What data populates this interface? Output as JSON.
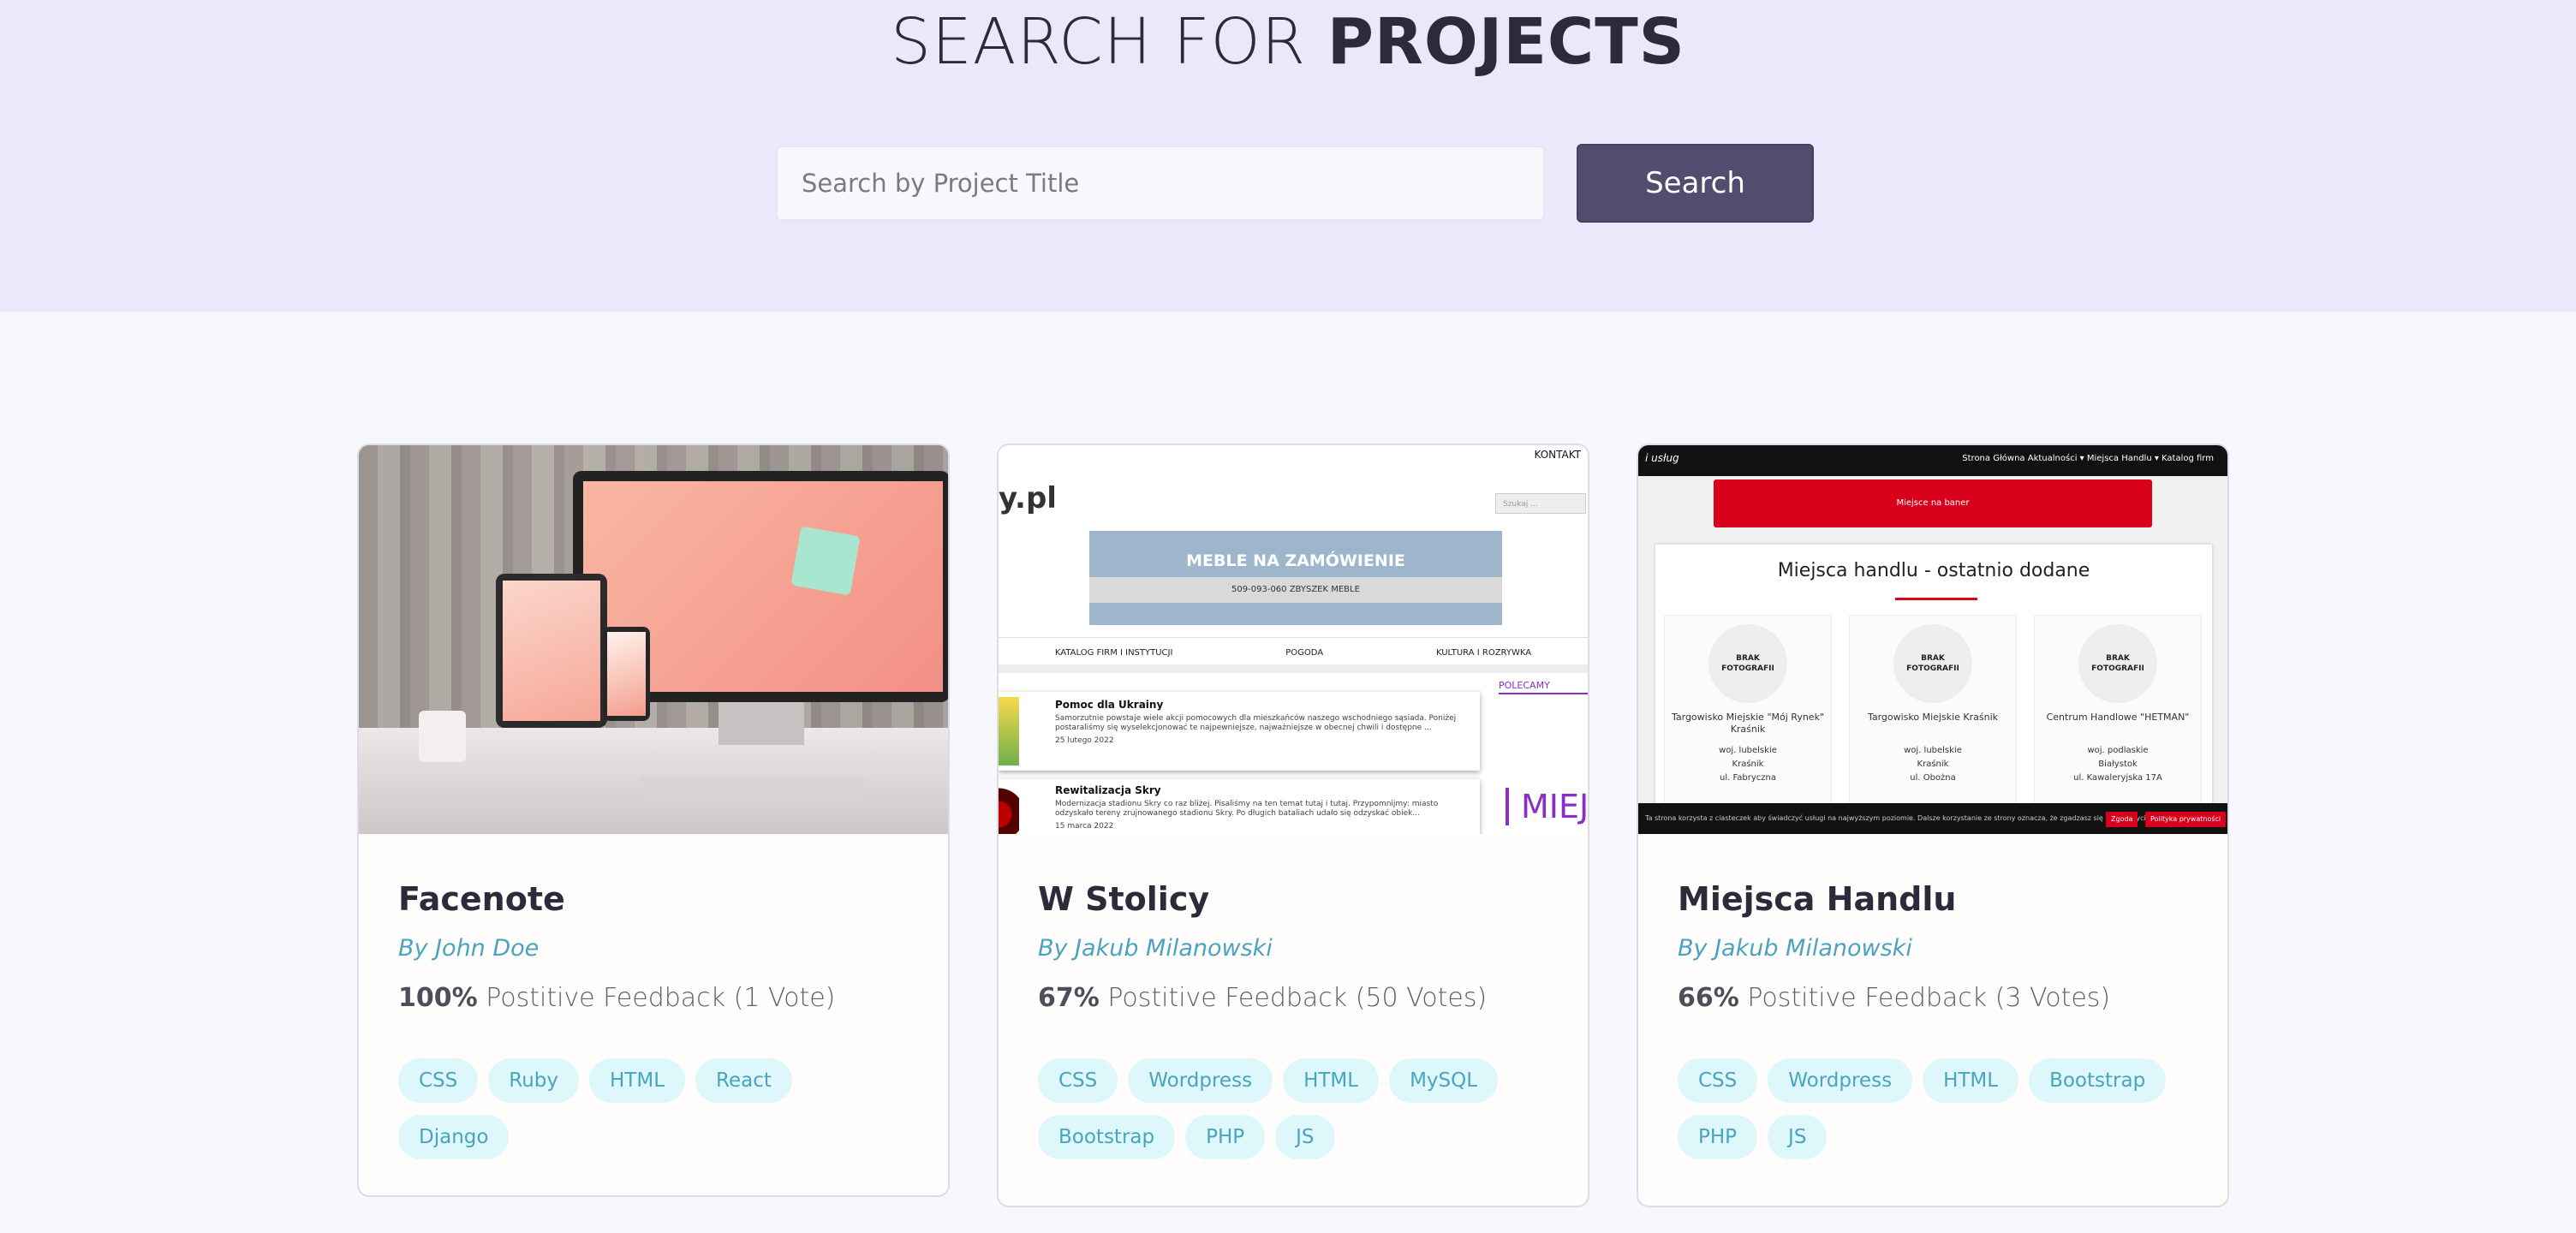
{
  "hero": {
    "title_light": "SEARCH FOR ",
    "title_bold": "PROJECTS",
    "search_placeholder": "Search by Project Title",
    "search_button": "Search"
  },
  "colors": {
    "hero_bg": "#ebe8fc",
    "page_bg": "#f7f8fd",
    "button_bg": "#524c6f",
    "author": "#4aa4c0",
    "tag_bg": "#def7fa"
  },
  "projects": [
    {
      "title": "Facenote",
      "author": "By John Doe",
      "feedback_percent": "100%",
      "feedback_text": " Postitive Feedback (1 Vote)",
      "tags": [
        "CSS",
        "Ruby",
        "HTML",
        "React",
        "Django"
      ],
      "thumbnail": {}
    },
    {
      "title": "W Stolicy",
      "author": "By Jakub Milanowski",
      "feedback_percent": "67%",
      "feedback_text": " Postitive Feedback (50 Votes)",
      "tags": [
        "CSS",
        "Wordpress",
        "HTML",
        "MySQL",
        "Bootstrap",
        "PHP",
        "JS"
      ],
      "thumbnail": {
        "kontakt": "KONTAKT",
        "logo": "y.pl",
        "search": "Szukaj ...",
        "banner_title": "MEBLE NA ZAMÓWIENIE",
        "banner_strip": "509-093-060      ZBYSZEK MEBLE",
        "nav": [
          "KATALOG FIRM I INSTYTUCJI",
          "POGODA",
          "KULTURA I ROZRYWKA"
        ],
        "news1_title": "Pomoc dla Ukrainy",
        "news1_text": "Samorzutnie powstaje wiele akcji pomocowych dla mieszkańców naszego wschodniego sąsiada. Poniżej postaraliśmy się wyselekcjonować te najpewniejsze, najważniejsze w obecnej chwili i dostępne ...",
        "news1_date": "25 lutego 2022",
        "news2_title": "Rewitalizacja Skry",
        "news2_text": "Modernizacja stadionu Skry co raz bliżej. Pisaliśmy na ten temat tutaj i tutaj. Przypomnijmy: miasto odzyskało tereny zrujnowanego stadionu Skry. Po długich bataliach udało się odzyskać obiek...",
        "news2_date": "15 marca 2022",
        "polecamy": "POLECAMY",
        "miej": "MIEJ"
      }
    },
    {
      "title": "Miejsca Handlu",
      "author": "By Jakub Milanowski",
      "feedback_percent": "66%",
      "feedback_text": " Postitive Feedback (3 Votes)",
      "tags": [
        "CSS",
        "Wordpress",
        "HTML",
        "Bootstrap",
        "PHP",
        "JS"
      ],
      "thumbnail": {
        "logo": "i usług",
        "menu": "Strona Główna   Aktualności ▾   Miejsca Handlu ▾   Katalog firm",
        "ad": "Miejsce na baner",
        "heading": "Miejsca handlu - ostatnio dodane",
        "photo_label": "BRAK FOTOGRAFII",
        "items": [
          {
            "name": "Targowisko Miejskie \"Mój Rynek\" Kraśnik",
            "region": "woj. lubelskie",
            "city": "Kraśnik",
            "street": "ul. Fabryczna"
          },
          {
            "name": "Targowisko Miejskie Kraśnik",
            "region": "woj. lubelskie",
            "city": "Kraśnik",
            "street": "ul. Obożna"
          },
          {
            "name": "Centrum Handlowe \"HETMAN\"",
            "region": "woj. podlaskie",
            "city": "Białystok",
            "street": "ul. Kawaleryjska 17A"
          }
        ],
        "cookie_text": "Ta strona korzysta z ciasteczek aby świadczyć usługi na najwyższym poziomie. Dalsze korzystanie ze strony oznacza, że zgadzasz się na ich użycie.",
        "cookie_ok": "Zgoda",
        "cookie_policy": "Polityka prywatności"
      }
    }
  ]
}
